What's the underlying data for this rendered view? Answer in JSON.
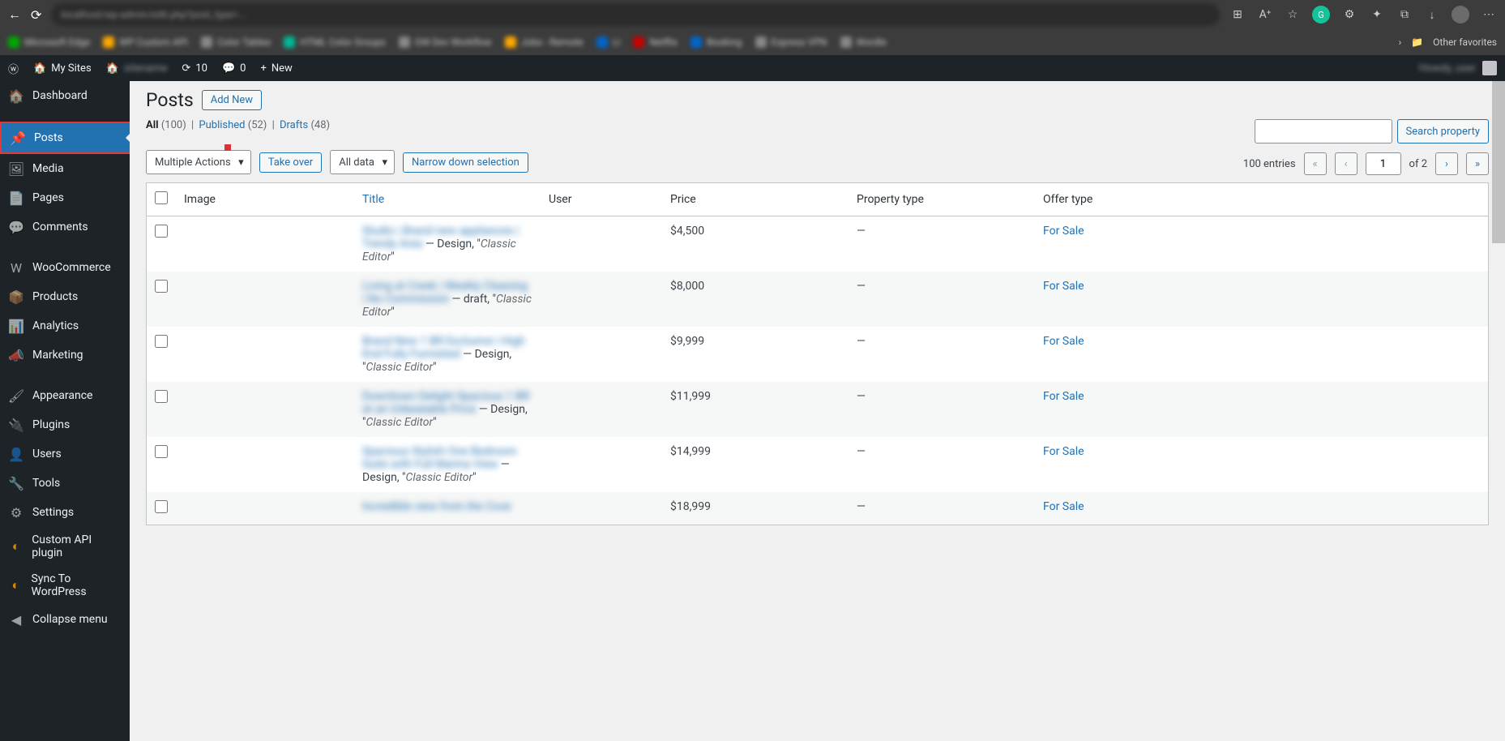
{
  "browser": {
    "url_blur": "localhost/wp-admin/edit.php?post_type=...",
    "other_favorites": "Other favorites"
  },
  "adminbar": {
    "my_sites": "My Sites",
    "updates": "10",
    "comments": "0",
    "new": "New",
    "user_blur": "Howdy, user"
  },
  "sidebar": {
    "items": [
      {
        "icon": "dashboard",
        "label": "Dashboard"
      },
      {
        "icon": "pin",
        "label": "Posts"
      },
      {
        "icon": "media",
        "label": "Media"
      },
      {
        "icon": "page",
        "label": "Pages"
      },
      {
        "icon": "comment",
        "label": "Comments"
      },
      {
        "icon": "woo",
        "label": "WooCommerce"
      },
      {
        "icon": "products",
        "label": "Products"
      },
      {
        "icon": "analytics",
        "label": "Analytics"
      },
      {
        "icon": "marketing",
        "label": "Marketing"
      },
      {
        "icon": "appearance",
        "label": "Appearance"
      },
      {
        "icon": "plugins",
        "label": "Plugins"
      },
      {
        "icon": "users",
        "label": "Users"
      },
      {
        "icon": "tools",
        "label": "Tools"
      },
      {
        "icon": "settings",
        "label": "Settings"
      },
      {
        "icon": "api",
        "label": "Custom API plugin"
      },
      {
        "icon": "sync",
        "label": "Sync To WordPress"
      },
      {
        "icon": "collapse",
        "label": "Collapse menu"
      }
    ]
  },
  "page": {
    "title": "Posts",
    "add_new": "Add New",
    "filters": {
      "all_label": "All",
      "all_count": "(100)",
      "published_label": "Published",
      "published_count": "(52)",
      "drafts_label": "Drafts",
      "drafts_count": "(48)"
    },
    "search_btn": "Search property",
    "actions": {
      "multiple": "Multiple Actions",
      "take_over": "Take over",
      "all_data": "All data",
      "narrow": "Narrow down selection"
    },
    "tablenav": {
      "entries": "100 entries",
      "page": "1",
      "of": "of 2"
    },
    "columns": {
      "image": "Image",
      "title": "Title",
      "user": "User",
      "price": "Price",
      "ptype": "Property type",
      "otype": "Offer type"
    },
    "rows": [
      {
        "title_blur": "Studio | Brand new appliances | Trendy Area",
        "meta_prefix": " — Design, \"",
        "meta_italic": "Classic Editor",
        "meta_suffix": "\"",
        "price": "$4,500",
        "ptype": "—",
        "otype": "For Sale"
      },
      {
        "title_blur": "Living at Creek | Weekly Cleaning | No Commission",
        "meta_prefix": " — draft, \"",
        "meta_italic": "Classic Editor",
        "meta_suffix": "\"",
        "price": "$8,000",
        "ptype": "—",
        "otype": "For Sale"
      },
      {
        "title_blur": "Brand New 1 BR Exclusive | High End Fully Furnished",
        "meta_prefix": " — Design, \"",
        "meta_italic": "Classic Editor",
        "meta_suffix": "\"",
        "price": "$9,999",
        "ptype": "—",
        "otype": "For Sale"
      },
      {
        "title_blur": "Downtown Delight Spacious 1 BR at an Unbeatable Price",
        "meta_prefix": " — Design, \"",
        "meta_italic": "Classic Editor",
        "meta_suffix": "\"",
        "price": "$11,999",
        "ptype": "—",
        "otype": "For Sale"
      },
      {
        "title_blur": "Spacious Stylish One Bedroom Suite with Full Marina View",
        "meta_prefix": " — Design, \"",
        "meta_italic": "Classic Editor",
        "meta_suffix": "\"",
        "price": "$14,999",
        "ptype": "—",
        "otype": "For Sale"
      },
      {
        "title_blur": "Incredible view from the Cove",
        "meta_prefix": "",
        "meta_italic": "",
        "meta_suffix": "",
        "price": "$18,999",
        "ptype": "—",
        "otype": "For Sale"
      }
    ]
  }
}
